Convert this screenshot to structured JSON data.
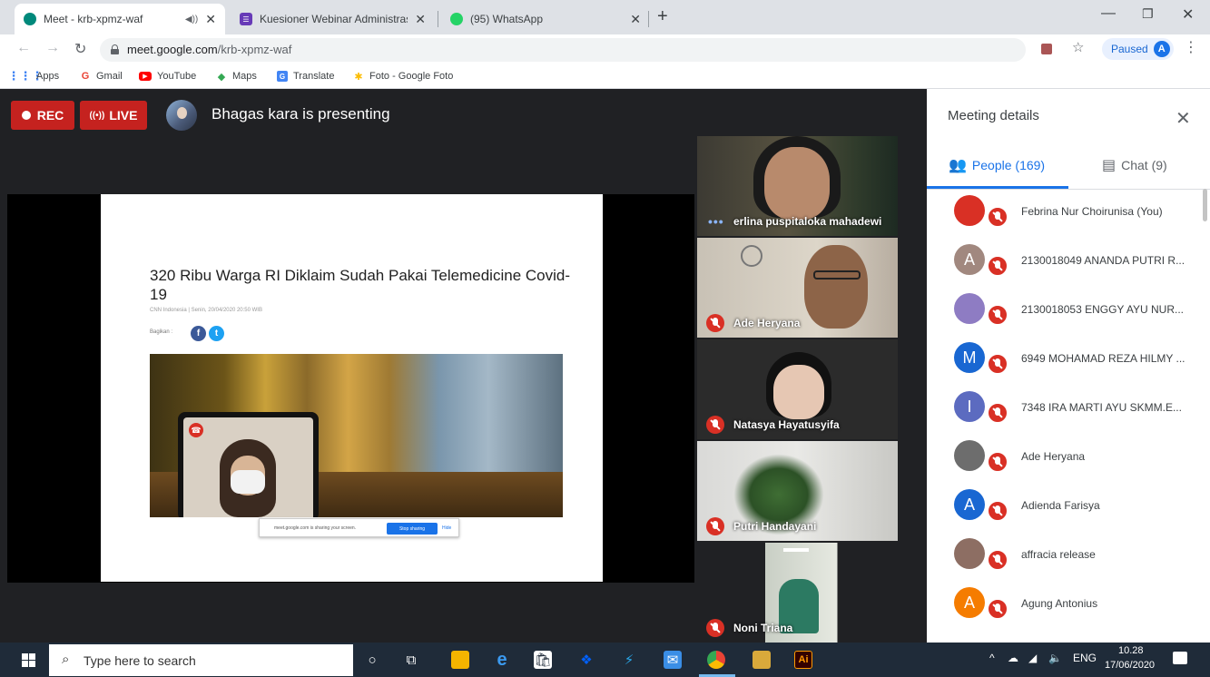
{
  "browser": {
    "tabs": [
      {
        "title": "Meet - krb-xpmz-waf",
        "active": true
      },
      {
        "title": "Kuesioner Webinar Administrasi"
      },
      {
        "title": "(95) WhatsApp"
      }
    ],
    "url_domain": "meet.google.com",
    "url_path": "/krb-xpmz-waf",
    "profile_label": "Paused",
    "profile_initial": "A",
    "bookmarks": [
      "Apps",
      "Gmail",
      "YouTube",
      "Maps",
      "Translate",
      "Foto - Google Foto"
    ]
  },
  "meet": {
    "rec_label": "REC",
    "live_label": "LIVE",
    "presenting_text": "Bhagas kara is presenting",
    "shared_screen": {
      "article_title": "320 Ribu Warga RI Diklaim Sudah Pakai Telemedicine Covid-19",
      "article_meta": "CNN Indonesia | Senin, 20/04/2020 20:50 WIB",
      "share_label": "Bagikan :",
      "notice_text": "meet.google.com is sharing your screen.",
      "stop_label": "Stop sharing",
      "hide_label": "Hide"
    },
    "participants_tiles": [
      {
        "name": "erlina puspitaloka mahadewi",
        "muted": false
      },
      {
        "name": "Ade Heryana",
        "muted": true
      },
      {
        "name": "Natasya Hayatusyifa",
        "muted": true
      },
      {
        "name": "Putri Handayani",
        "muted": true
      },
      {
        "name": "Noni Triana",
        "muted": true
      }
    ]
  },
  "panel": {
    "title": "Meeting details",
    "people_tab": "People (169)",
    "chat_tab": "Chat (9)",
    "people": [
      {
        "name": "Febrina Nur Choirunisa (You)",
        "initial": "",
        "color": "#d93025"
      },
      {
        "name": "2130018049 ANANDA PUTRI R...",
        "initial": "A",
        "color": "#a1887f"
      },
      {
        "name": "2130018053 ENGGY AYU NUR...",
        "initial": "",
        "color": "#8e7cc3"
      },
      {
        "name": "6949 MOHAMAD REZA HILMY ...",
        "initial": "M",
        "color": "#1967d2"
      },
      {
        "name": "7348 IRA MARTI AYU SKMM.E...",
        "initial": "I",
        "color": "#5c6bc0"
      },
      {
        "name": "Ade Heryana",
        "initial": "",
        "color": "#6d6d6d"
      },
      {
        "name": "Adienda Farisya",
        "initial": "A",
        "color": "#1967d2"
      },
      {
        "name": "affracia release",
        "initial": "",
        "color": "#8d6e63"
      },
      {
        "name": "Agung Antonius",
        "initial": "A",
        "color": "#f57c00"
      }
    ]
  },
  "taskbar": {
    "search_placeholder": "Type here to search",
    "lang": "ENG",
    "time": "10.28",
    "date": "17/06/2020"
  }
}
